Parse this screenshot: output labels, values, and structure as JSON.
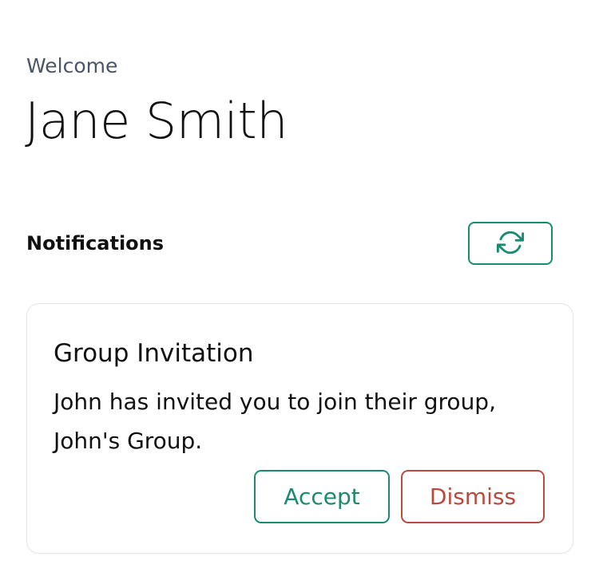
{
  "header": {
    "welcome_label": "Welcome",
    "user_name": "Jane Smith"
  },
  "notifications": {
    "title": "Notifications",
    "refresh_icon": "refresh-icon",
    "items": [
      {
        "title": "Group Invitation",
        "message": "John has invited you to join their group, John's Group.",
        "accept_label": "Accept",
        "dismiss_label": "Dismiss"
      }
    ]
  },
  "colors": {
    "accent": "#1a8a70",
    "danger": "#b94a3e",
    "muted_text": "#4a5568",
    "text": "#111111",
    "card_border": "#e6e6e6"
  }
}
